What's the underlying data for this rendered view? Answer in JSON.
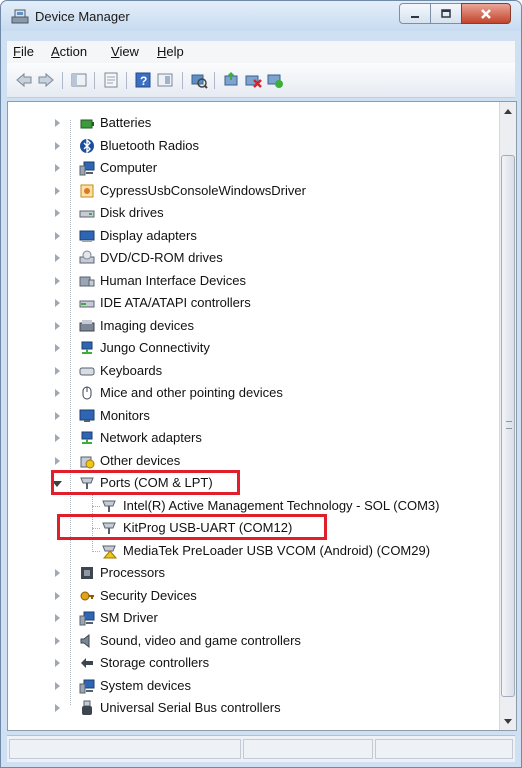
{
  "window": {
    "title": "Device Manager"
  },
  "menu": [
    {
      "label": "File",
      "accel": "F",
      "rest": "ile"
    },
    {
      "label": "Action",
      "accel": "A",
      "rest": "ction"
    },
    {
      "label": "View",
      "accel": "V",
      "rest": "iew"
    },
    {
      "label": "Help",
      "accel": "H",
      "rest": "elp"
    }
  ],
  "tree": [
    {
      "label": "Batteries",
      "icon": "battery-icon",
      "state": "collapsed"
    },
    {
      "label": "Bluetooth Radios",
      "icon": "bluetooth-icon",
      "state": "collapsed"
    },
    {
      "label": "Computer",
      "icon": "computer-icon",
      "state": "collapsed"
    },
    {
      "label": "CypressUsbConsoleWindowsDriver",
      "icon": "driver-icon",
      "state": "collapsed"
    },
    {
      "label": "Disk drives",
      "icon": "disk-drive-icon",
      "state": "collapsed"
    },
    {
      "label": "Display adapters",
      "icon": "display-adapter-icon",
      "state": "collapsed"
    },
    {
      "label": "DVD/CD-ROM drives",
      "icon": "dvd-drive-icon",
      "state": "collapsed"
    },
    {
      "label": "Human Interface Devices",
      "icon": "hid-icon",
      "state": "collapsed"
    },
    {
      "label": "IDE ATA/ATAPI controllers",
      "icon": "ide-controller-icon",
      "state": "collapsed"
    },
    {
      "label": "Imaging devices",
      "icon": "imaging-device-icon",
      "state": "collapsed"
    },
    {
      "label": "Jungo Connectivity",
      "icon": "network-icon",
      "state": "collapsed"
    },
    {
      "label": "Keyboards",
      "icon": "keyboard-icon",
      "state": "collapsed"
    },
    {
      "label": "Mice and other pointing devices",
      "icon": "mouse-icon",
      "state": "collapsed"
    },
    {
      "label": "Monitors",
      "icon": "monitor-icon",
      "state": "collapsed"
    },
    {
      "label": "Network adapters",
      "icon": "network-adapter-icon",
      "state": "collapsed"
    },
    {
      "label": "Other devices",
      "icon": "unknown-device-icon",
      "state": "collapsed"
    },
    {
      "label": "Ports (COM & LPT)",
      "icon": "port-icon",
      "state": "expanded",
      "highlight": true,
      "children": [
        {
          "label": "Intel(R) Active Management Technology - SOL (COM3)",
          "icon": "port-icon"
        },
        {
          "label": "KitProg USB-UART (COM12)",
          "icon": "port-icon",
          "highlight": true
        },
        {
          "label": "MediaTek PreLoader USB VCOM (Android) (COM29)",
          "icon": "port-warning-icon"
        }
      ]
    },
    {
      "label": "Processors",
      "icon": "processor-icon",
      "state": "collapsed"
    },
    {
      "label": "Security Devices",
      "icon": "security-device-icon",
      "state": "collapsed"
    },
    {
      "label": "SM Driver",
      "icon": "computer-icon",
      "state": "collapsed"
    },
    {
      "label": "Sound, video and game controllers",
      "icon": "speaker-icon",
      "state": "collapsed"
    },
    {
      "label": "Storage controllers",
      "icon": "storage-controller-icon",
      "state": "collapsed"
    },
    {
      "label": "System devices",
      "icon": "computer-icon",
      "state": "collapsed"
    },
    {
      "label": "Universal Serial Bus controllers",
      "icon": "usb-icon",
      "state": "collapsed"
    }
  ],
  "colors": {
    "highlight_border": "#e01f2b"
  }
}
